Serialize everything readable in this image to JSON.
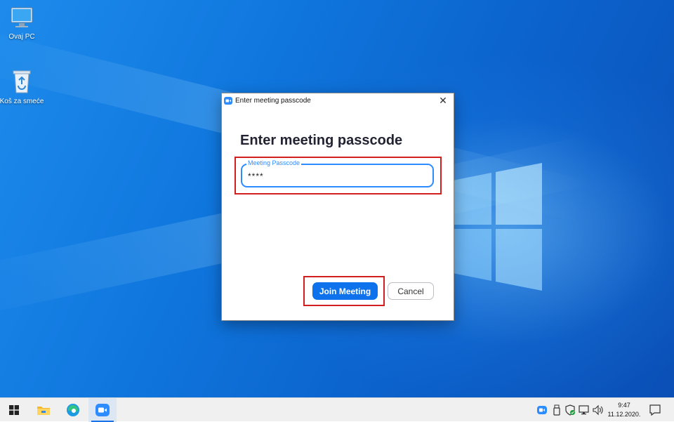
{
  "desktop": {
    "icons": [
      {
        "label": "Ovaj PC"
      },
      {
        "label": "Koš za smeće"
      }
    ]
  },
  "dialog": {
    "window_title": "Enter meeting passcode",
    "heading": "Enter meeting passcode",
    "passcode_field": {
      "label": "Meeting Passcode",
      "value": "****"
    },
    "join_label": "Join Meeting",
    "cancel_label": "Cancel",
    "close_glyph": "✕"
  },
  "taskbar": {
    "apps": [
      "windows-start-icon",
      "file-explorer-icon",
      "edge-icon",
      "zoom-icon"
    ],
    "tray": [
      "zoom-tray-icon",
      "usb-icon",
      "security-icon",
      "network-icon",
      "volume-icon"
    ],
    "time": "9:47",
    "date": "11.12.2020."
  },
  "colors": {
    "highlight": "#d11e1e",
    "zoom_blue": "#0e72ed",
    "field_blue": "#2d8cff"
  }
}
